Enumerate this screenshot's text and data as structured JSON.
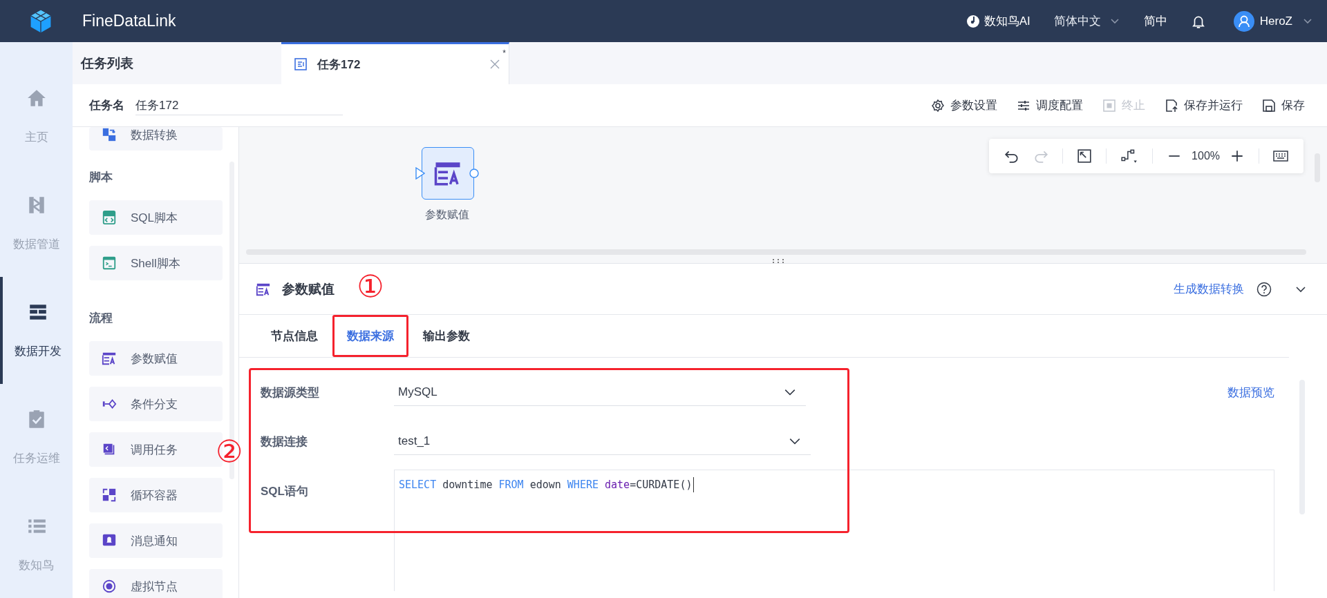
{
  "app": {
    "name": "FineDataLink"
  },
  "header": {
    "ai_label": "数知鸟AI",
    "language": "简体中文",
    "short_language": "简中",
    "user": "HeroZ"
  },
  "nav": [
    {
      "label": "主页",
      "kind": "home",
      "selected": false
    },
    {
      "label": "数据管道",
      "kind": "pipeline",
      "selected": false
    },
    {
      "label": "数据开发",
      "kind": "develop",
      "selected": true
    },
    {
      "label": "任务运维",
      "kind": "ops",
      "selected": false
    },
    {
      "label": "数知鸟",
      "kind": "list",
      "selected": false
    }
  ],
  "task_list_title": "任务列表",
  "tabs": [
    {
      "label": "任务172",
      "selected": true,
      "modified_mark": "*"
    }
  ],
  "task_name": {
    "label": "任务名",
    "value": "任务172"
  },
  "actions": [
    {
      "label": "参数设置",
      "kind": "settings",
      "disabled": false
    },
    {
      "label": "调度配置",
      "kind": "schedule",
      "disabled": false
    },
    {
      "label": "终止",
      "kind": "stop",
      "disabled": true
    },
    {
      "label": "保存并运行",
      "kind": "save-run",
      "disabled": false
    },
    {
      "label": "保存",
      "kind": "save",
      "disabled": false
    }
  ],
  "palette": [
    {
      "items": [
        {
          "label": "数据转换",
          "kind": "transform"
        }
      ]
    },
    {
      "title": "脚本",
      "items": [
        {
          "label": "SQL脚本",
          "kind": "sql"
        },
        {
          "label": "Shell脚本",
          "kind": "shell"
        }
      ]
    },
    {
      "title": "流程",
      "items": [
        {
          "label": "参数赋值",
          "kind": "assign"
        },
        {
          "label": "条件分支",
          "kind": "branch"
        },
        {
          "label": "调用任务",
          "kind": "invoke"
        },
        {
          "label": "循环容器",
          "kind": "loop"
        },
        {
          "label": "消息通知",
          "kind": "notify"
        },
        {
          "label": "虚拟节点",
          "kind": "virtual"
        }
      ]
    }
  ],
  "canvas": {
    "nodes": [
      {
        "label": "参数赋值",
        "kind": "assign",
        "selected": true
      }
    ],
    "toolbar": {
      "undo_disabled": false,
      "redo_disabled": true,
      "zoom": "100%"
    }
  },
  "panel": {
    "title": "参数赋值",
    "link": "生成数据转换",
    "tabs": [
      {
        "label": "节点信息",
        "selected": false,
        "highlighted": false
      },
      {
        "label": "数据来源",
        "selected": true,
        "highlighted": true,
        "callout": "①"
      },
      {
        "label": "输出参数",
        "selected": false,
        "highlighted": false
      }
    ],
    "form": {
      "highlighted": true,
      "callout": "②",
      "preview_link": "数据预览",
      "fields": [
        {
          "label": "数据源类型",
          "value": "MySQL"
        },
        {
          "label": "数据连接",
          "value": "test_1"
        }
      ],
      "sql_label": "SQL语句",
      "sql": [
        {
          "text": "SELECT",
          "kind": "keyword"
        },
        {
          "text": " downtime ",
          "kind": "plain"
        },
        {
          "text": "FROM",
          "kind": "keyword"
        },
        {
          "text": " edown ",
          "kind": "plain"
        },
        {
          "text": "WHERE",
          "kind": "keyword"
        },
        {
          "text": " date",
          "kind": "builtin"
        },
        {
          "text": "=CURDATE()",
          "kind": "plain"
        }
      ]
    }
  }
}
